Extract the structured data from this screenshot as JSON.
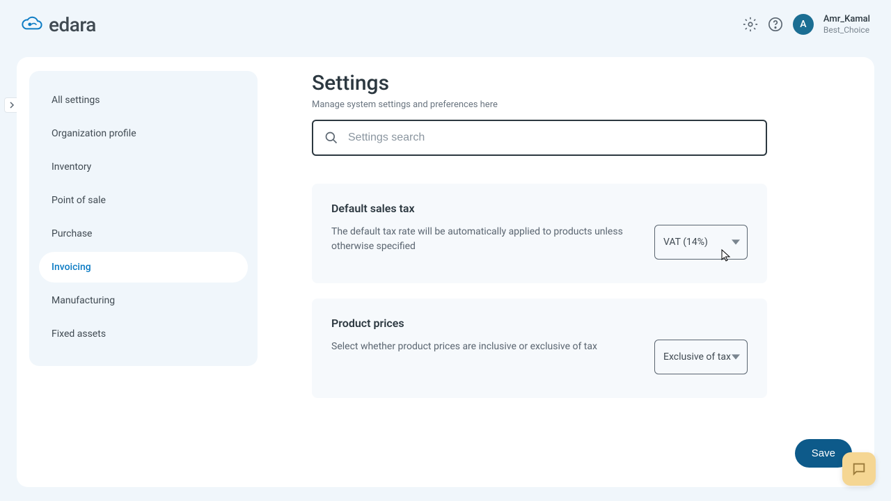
{
  "brand": "edara",
  "user": {
    "initial": "A",
    "name": "Amr_Kamal",
    "org": "Best_Choice"
  },
  "sidebar": {
    "items": [
      {
        "label": "All settings"
      },
      {
        "label": "Organization profile"
      },
      {
        "label": "Inventory"
      },
      {
        "label": "Point of sale"
      },
      {
        "label": "Purchase"
      },
      {
        "label": "Invoicing"
      },
      {
        "label": "Manufacturing"
      },
      {
        "label": "Fixed assets"
      }
    ],
    "active_index": 5
  },
  "page": {
    "title": "Settings",
    "subtitle": "Manage system settings and preferences here",
    "search_placeholder": "Settings search"
  },
  "cards": [
    {
      "title": "Default sales tax",
      "desc": "The default tax rate will be automatically applied to products unless otherwise specified",
      "value": "VAT (14%)"
    },
    {
      "title": "Product prices",
      "desc": "Select whether product prices are inclusive or exclusive of tax",
      "value": "Exclusive of tax"
    }
  ],
  "save_label": "Save"
}
